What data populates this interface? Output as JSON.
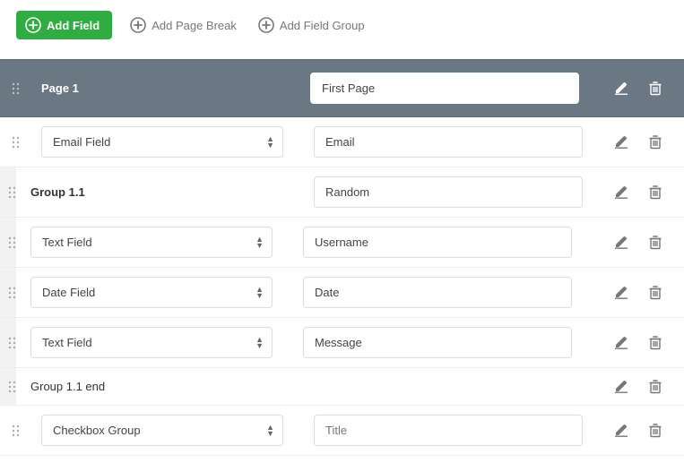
{
  "toolbar": {
    "add_field": "Add Field",
    "add_page_break": "Add Page Break",
    "add_field_group": "Add Field Group"
  },
  "page": {
    "title_label": "Page 1",
    "title_value": "First Page"
  },
  "rows": [
    {
      "kind": "field",
      "select": "Email Field",
      "value": "Email"
    },
    {
      "kind": "group-start",
      "label": "Group 1.1",
      "value": "Random"
    },
    {
      "kind": "field",
      "select": "Text Field",
      "value": "Username",
      "nested": true
    },
    {
      "kind": "field",
      "select": "Date Field",
      "value": "Date",
      "nested": true
    },
    {
      "kind": "field",
      "select": "Text Field",
      "value": "Message",
      "nested": true
    },
    {
      "kind": "group-end",
      "label": "Group 1.1 end",
      "nested": true
    },
    {
      "kind": "field",
      "select": "Checkbox Group",
      "placeholder": "Title"
    }
  ]
}
